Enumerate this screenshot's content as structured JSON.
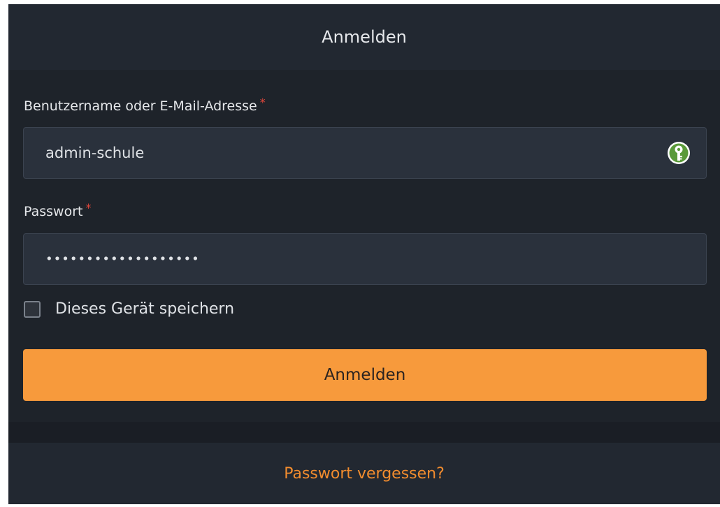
{
  "header": {
    "title": "Anmelden"
  },
  "form": {
    "username": {
      "label": "Benutzername oder E-Mail-Adresse",
      "required_mark": "*",
      "value": "admin-schule"
    },
    "password": {
      "label": "Passwort",
      "required_mark": "*",
      "masked_value": "•••••••••••••••••••"
    },
    "remember": {
      "label": "Dieses Gerät speichern",
      "checked": false
    },
    "submit_label": "Anmelden"
  },
  "footer": {
    "forgot_link": "Passwort vergessen?"
  },
  "colors": {
    "accent": "#f79a3c",
    "link": "#f28c2e",
    "required": "#e0463b",
    "background": "#1e232a"
  },
  "icons": {
    "password_manager": "keepassxc-key-icon"
  }
}
